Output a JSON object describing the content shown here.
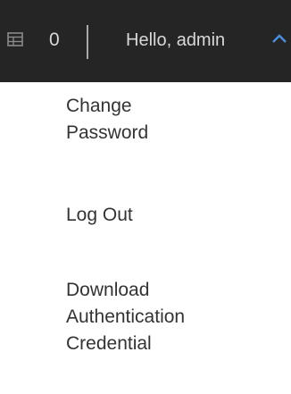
{
  "topbar": {
    "cart_count": "0",
    "greeting": "Hello, admin",
    "icons": {
      "table": "table-icon",
      "chevron": "chevron-up-icon"
    },
    "accent_color": "#4a90e2"
  },
  "menu": {
    "items": [
      {
        "label": "Change\nPassword"
      },
      {
        "label": "Log Out"
      },
      {
        "label": "Download\nAuthentication\nCredential"
      }
    ]
  }
}
